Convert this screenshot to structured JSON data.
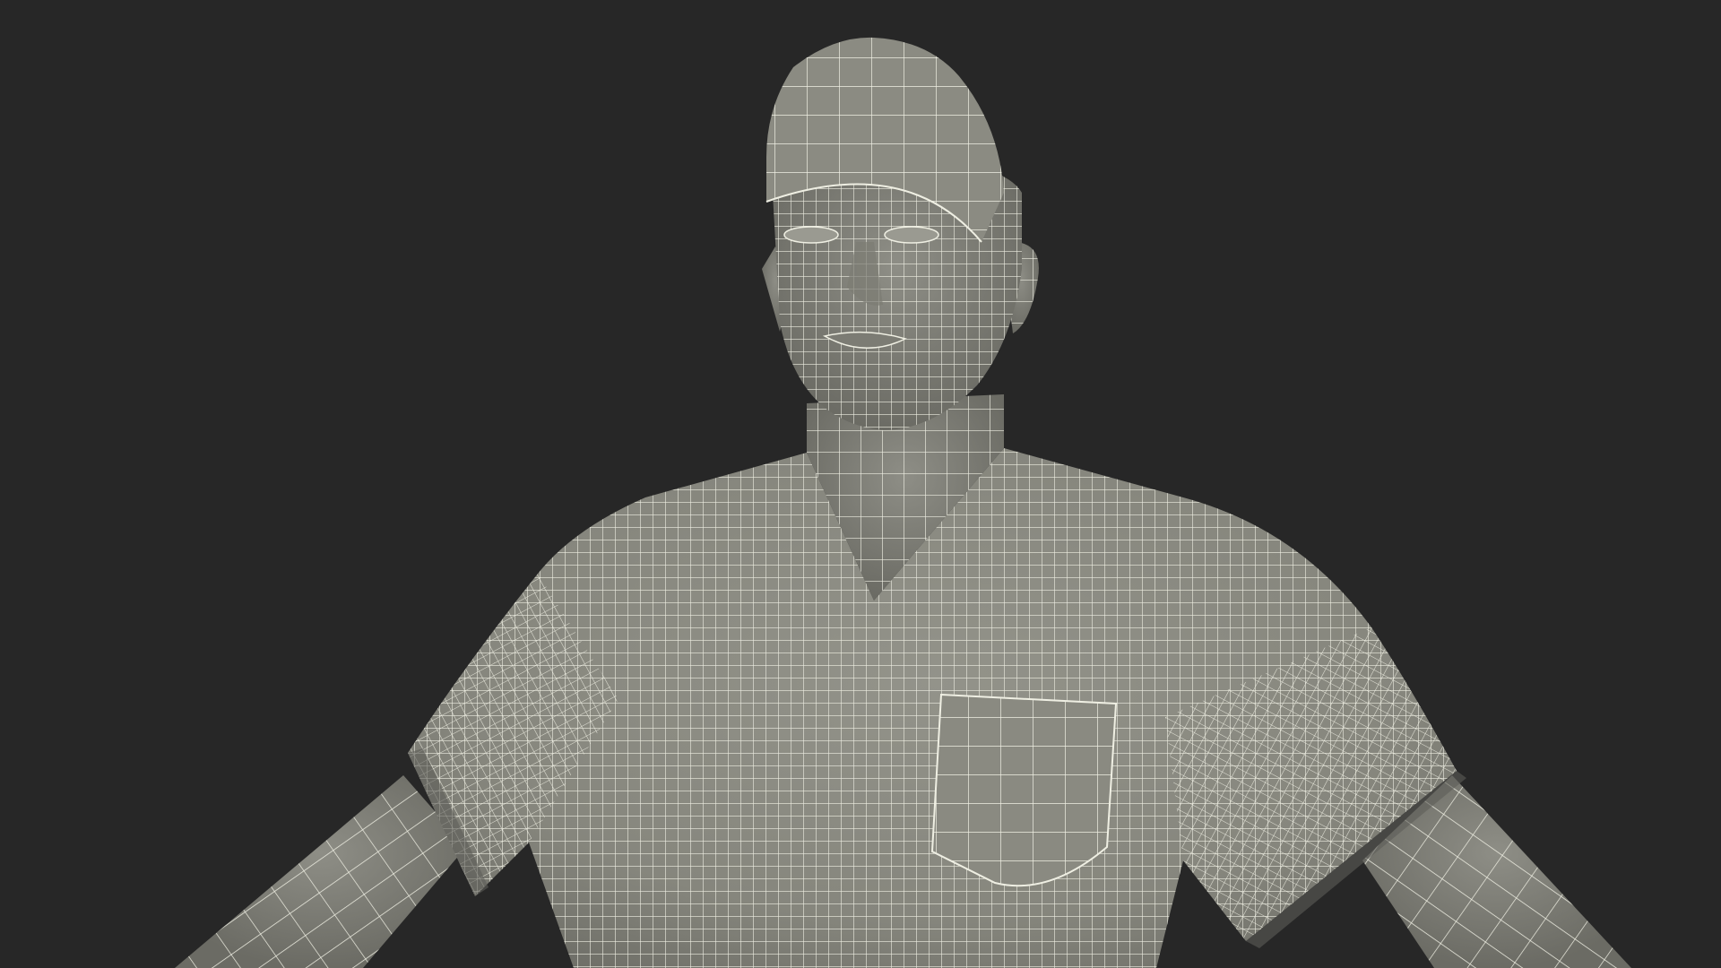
{
  "scene": {
    "subject": "wireframe-male-in-scrubs-and-cap",
    "colors": {
      "background": "#272727",
      "surface": "#8b8b82",
      "surface_shade": "#6f6f67",
      "surface_dark": "#55554f",
      "wire": "#f1f1e6"
    }
  }
}
